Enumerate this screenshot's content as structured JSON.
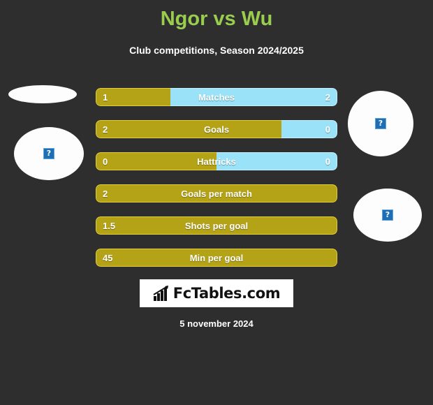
{
  "header": {
    "title": "Ngor vs Wu",
    "subtitle": "Club competitions, Season 2024/2025",
    "title_color": "#9acd4e"
  },
  "colors": {
    "background": "#2e2e2e",
    "home_bar": "#b5a317",
    "home_border": "#e2cf3a",
    "away_bar": "#9ae2f7",
    "away_border": "#c7f0fb",
    "text": "#ffffff"
  },
  "placeholders": [
    {
      "name": "home-player-photo",
      "alt_icon": "broken-image-icon",
      "glyph": "?"
    },
    {
      "name": "home-club-logo",
      "alt_icon": "broken-image-icon",
      "glyph": "?"
    },
    {
      "name": "away-player-photo",
      "alt_icon": "broken-image-icon",
      "glyph": "?"
    },
    {
      "name": "away-club-logo",
      "alt_icon": "broken-image-icon",
      "glyph": "?"
    }
  ],
  "chart_data": {
    "type": "bar",
    "title": "Ngor vs Wu",
    "subtitle": "Club competitions, Season 2024/2025",
    "orientation": "horizontal-diverging",
    "categories": [
      "Matches",
      "Goals",
      "Hattricks",
      "Goals per match",
      "Shots per goal",
      "Min per goal"
    ],
    "series": [
      {
        "name": "Ngor",
        "values": [
          "1",
          "2",
          "0",
          "2",
          "1.5",
          "45"
        ]
      },
      {
        "name": "Wu",
        "values": [
          "2",
          "0",
          "0",
          "",
          "",
          ""
        ]
      }
    ],
    "rows": [
      {
        "label": "Matches",
        "home": "1",
        "away": "2",
        "home_pct": 31,
        "has_away": true
      },
      {
        "label": "Goals",
        "home": "2",
        "away": "0",
        "home_pct": 77,
        "has_away": true
      },
      {
        "label": "Hattricks",
        "home": "0",
        "away": "0",
        "home_pct": 50,
        "has_away": true
      },
      {
        "label": "Goals per match",
        "home": "2",
        "away": "",
        "home_pct": 100,
        "has_away": false
      },
      {
        "label": "Shots per goal",
        "home": "1.5",
        "away": "",
        "home_pct": 100,
        "has_away": false
      },
      {
        "label": "Min per goal",
        "home": "45",
        "away": "",
        "home_pct": 100,
        "has_away": false
      }
    ],
    "legend": [
      "Ngor",
      "Wu"
    ],
    "grid": false
  },
  "footer": {
    "logo_text": "FcTables.com",
    "logo_icon": "bar-chart-icon",
    "date": "5 november 2024"
  }
}
